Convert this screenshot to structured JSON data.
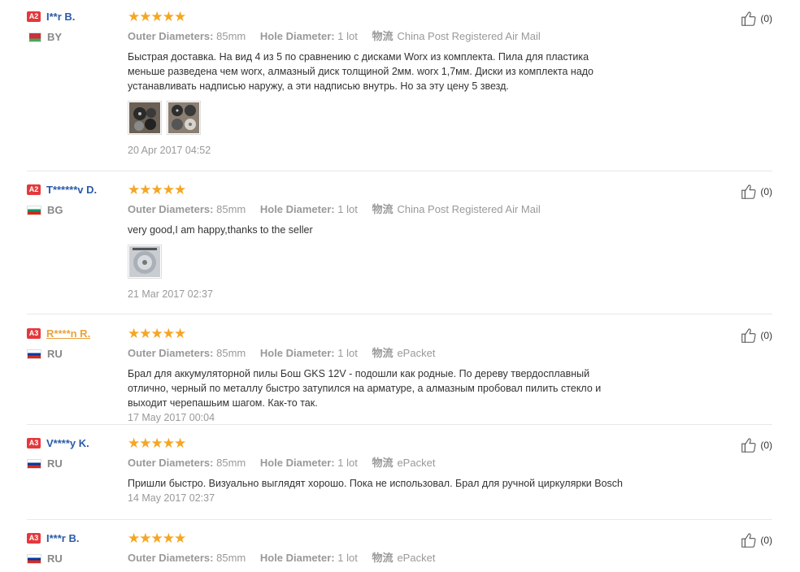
{
  "labels": {
    "outer_key": "Outer Diameters:",
    "hole_key": "Hole Diameter:",
    "ship_key": "物流"
  },
  "colors": {
    "star": "#f5a623",
    "badge": "#e4393c",
    "name": "#2b5aa8",
    "name_highlight": "#e8a33c"
  },
  "icons": {
    "rating": "star-icon",
    "helpful": "thumbs-up-icon"
  },
  "reviews": [
    {
      "badge": "A2",
      "name": "I**r B.",
      "country": "BY",
      "flag": "belarus-flag",
      "stars": "★★★★★",
      "outer": "85mm",
      "hole": "1 lot",
      "shipping": "China Post Registered Air Mail",
      "text": "Быстрая доставка. На вид 4 из 5 по сравнению с дисками Worx из комплекта. Пила для пластика меньше разведена чем worx, алмазный диск толщиной 2мм. worx 1,7мм. Диски из комплекта надо устанавливать надписью наружу, а эти надписью внутрь. Но за эту цену 5 звезд.",
      "date": "20 Apr 2017 04:52",
      "helpful": "(0)"
    },
    {
      "badge": "A2",
      "name": "T******v D.",
      "country": "BG",
      "flag": "bulgaria-flag",
      "stars": "★★★★★",
      "outer": "85mm",
      "hole": "1 lot",
      "shipping": "China Post Registered Air Mail",
      "text": "very good,I am happy,thanks to the seller",
      "date": "21 Mar 2017 02:37",
      "helpful": "(0)"
    },
    {
      "badge": "A3",
      "name": "R****n R.",
      "country": "RU",
      "flag": "russia-flag",
      "stars": "★★★★★",
      "outer": "85mm",
      "hole": "1 lot",
      "shipping": "ePacket",
      "text": "Брал для аккумуляторной пилы Бош GKS 12V - подошли как родные. По дереву твердосплавный отлично, черный по металлу быстро затупился на арматуре, а алмазным пробовал пилить стекло и выходит черепашьим шагом. Как-то так.",
      "date": "17 May 2017 00:04",
      "helpful": "(0)"
    },
    {
      "badge": "A3",
      "name": "V****y K.",
      "country": "RU",
      "flag": "russia-flag",
      "stars": "★★★★★",
      "outer": "85mm",
      "hole": "1 lot",
      "shipping": "ePacket",
      "text": "Пришли быстро. Визуально выглядят хорошо. Пока не использовал. Брал для ручной циркулярки Bosch",
      "date": "14 May 2017 02:37",
      "helpful": "(0)"
    },
    {
      "badge": "A3",
      "name": "I***r B.",
      "country": "RU",
      "flag": "russia-flag",
      "stars": "★★★★★",
      "outer": "85mm",
      "hole": "1 lot",
      "shipping": "ePacket",
      "helpful": "(0)"
    }
  ]
}
